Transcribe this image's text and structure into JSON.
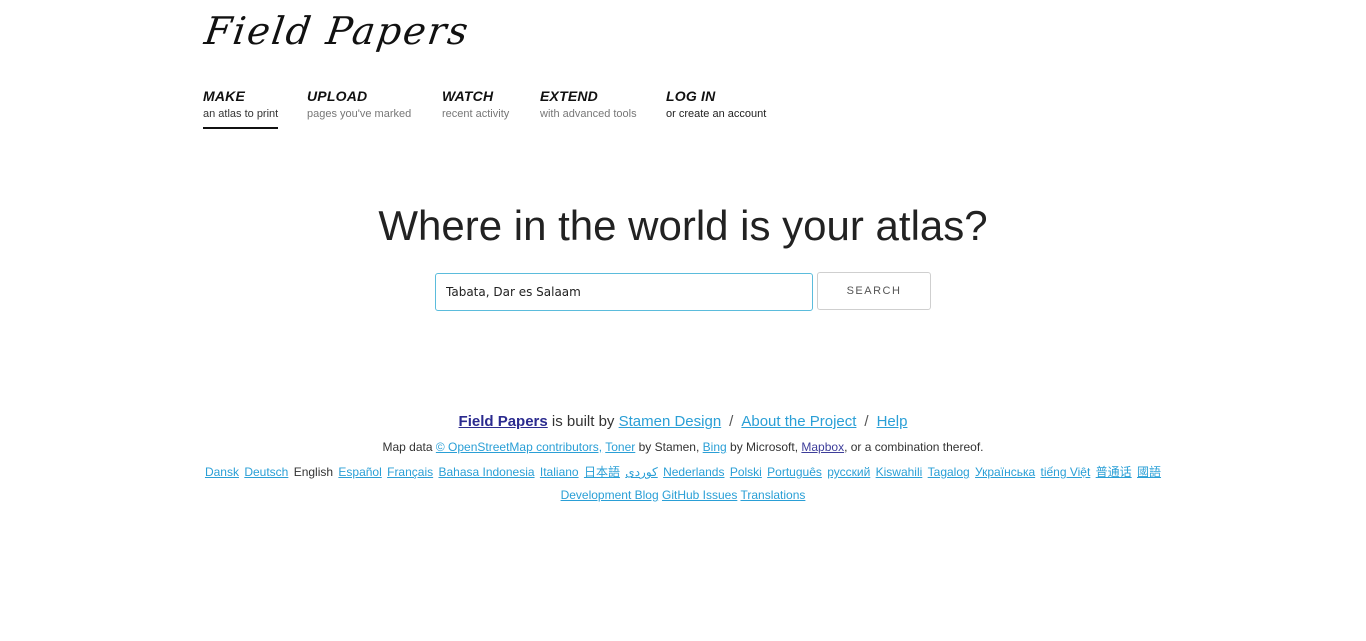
{
  "logo": {
    "text": "Field Papers"
  },
  "nav": [
    {
      "title": "MAKE",
      "sub": "an atlas to print"
    },
    {
      "title": "UPLOAD",
      "sub": "pages you've marked"
    },
    {
      "title": "WATCH",
      "sub": "recent activity"
    },
    {
      "title": "EXTEND",
      "sub": "with advanced tools"
    },
    {
      "title": "LOG IN",
      "sub": "or create an account"
    }
  ],
  "heading": "Where in the world is your atlas?",
  "search": {
    "value": "Tabata, Dar es Salaam",
    "button_label": "SEARCH"
  },
  "footer": {
    "brand_link": "Field Papers",
    "built_by_text": " is built by ",
    "stamen_link": "Stamen Design",
    "sep": "/",
    "about_link": "About the Project",
    "help_link": "Help",
    "mapdata_prefix": "Map data ",
    "osm_link": "© OpenStreetMap contributors,",
    "toner_link": "Toner",
    "by_stamen": " by Stamen, ",
    "bing_link": "Bing",
    "by_microsoft": " by Microsoft, ",
    "mapbox_link": "Mapbox",
    "mapdata_suffix": ", or a combination thereof.",
    "languages": [
      "Dansk",
      "Deutsch",
      "English",
      "Español",
      "Français",
      "Bahasa Indonesia",
      "Italiano",
      "日本語",
      "کوردی",
      "Nederlands",
      "Polski",
      "Português",
      "русский",
      "Kiswahili",
      "Tagalog",
      "Українська",
      "tiếng Việt",
      "普通话",
      "國語"
    ],
    "current_language": "English",
    "bottom_links": [
      "Development Blog",
      "GitHub Issues",
      "Translations"
    ]
  },
  "colors": {
    "link": "#2a9fd6",
    "brand_link": "#2b2b8f",
    "input_border": "#5bbcdc"
  }
}
